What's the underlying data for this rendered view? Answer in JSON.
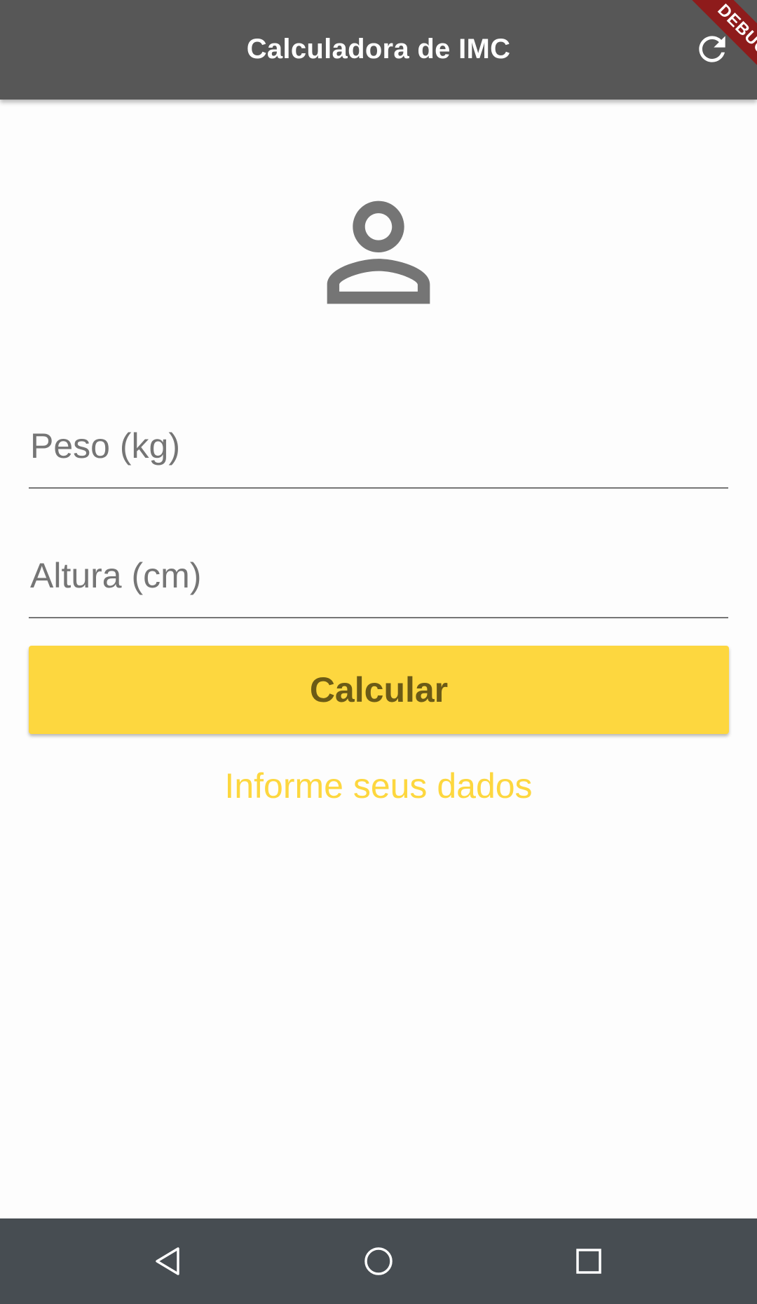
{
  "app_bar": {
    "title": "Calculadora de IMC",
    "refresh_icon": "refresh-icon",
    "background": "#575757"
  },
  "debug_banner": {
    "label": "DEBUG",
    "color": "#8e1b1b"
  },
  "avatar": {
    "icon": "person-outline-icon",
    "color": "#757575"
  },
  "form": {
    "peso_placeholder": "Peso (kg)",
    "peso_value": "",
    "altura_placeholder": "Altura (cm)",
    "altura_value": ""
  },
  "calculate_button": {
    "label": "Calcular",
    "background": "#fdd73f"
  },
  "info": {
    "text": "Informe seus dados",
    "color": "#fdd73f"
  },
  "nav_bar": {
    "back_icon": "back-triangle-icon",
    "home_icon": "home-circle-icon",
    "recents_icon": "recents-square-icon"
  }
}
